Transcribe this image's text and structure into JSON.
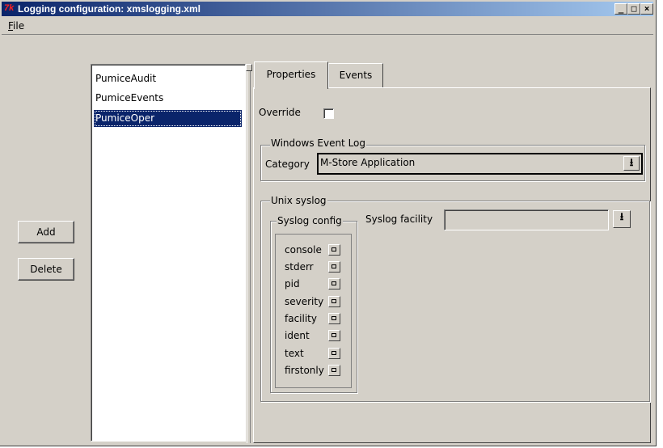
{
  "window": {
    "title": "Logging configuration: xmslogging.xml",
    "app_icon": "tk-feather-icon",
    "controls": {
      "minimize": "_",
      "maximize": "□",
      "close": "×"
    }
  },
  "menubar": {
    "file_label": "File",
    "file_mnemonic": "F",
    "file_rest": "ile"
  },
  "left_panel": {
    "add_label": "Add",
    "delete_label": "Delete"
  },
  "list": {
    "items": [
      "PumiceAudit",
      "PumiceEvents",
      "PumiceOper"
    ],
    "selected_index": 2
  },
  "tabs": [
    {
      "label": "Properties",
      "active": true
    },
    {
      "label": "Events",
      "active": false
    }
  ],
  "properties": {
    "override_label": "Override",
    "override_checked": false,
    "windows_group_label": "Windows Event Log",
    "category_label": "Category",
    "category_value": "M-Store Application",
    "unix_group_label": "Unix syslog",
    "syslog_config_label": "Syslog config",
    "syslog_facility_label": "Syslog facility",
    "syslog_facility_value": "",
    "syslog_options": [
      "console",
      "stderr",
      "pid",
      "severity",
      "facility",
      "ident",
      "text",
      "firstonly"
    ]
  },
  "icons": {
    "dropdown": "⭳"
  }
}
